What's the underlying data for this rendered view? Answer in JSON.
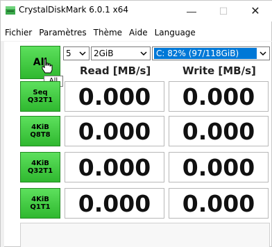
{
  "window": {
    "title": "CrystalDiskMark 6.0.1 x64",
    "minimize": "—",
    "maximize": "☐",
    "close": "✕"
  },
  "menu": [
    "Fichier",
    "Paramètres",
    "Thème",
    "Aide",
    "Language"
  ],
  "controls": {
    "all_label": "All",
    "tooltip": "All",
    "count_value": "5",
    "size_value": "2GiB",
    "drive_value": "C: 82% (97/118GiB)"
  },
  "headers": {
    "read": "Read [MB/s]",
    "write": "Write [MB/s]"
  },
  "tests": [
    {
      "line1": "Seq",
      "line2": "Q32T1",
      "read": "0.000",
      "write": "0.000"
    },
    {
      "line1": "4KiB",
      "line2": "Q8T8",
      "read": "0.000",
      "write": "0.000"
    },
    {
      "line1": "4KiB",
      "line2": "Q32T1",
      "read": "0.000",
      "write": "0.000"
    },
    {
      "line1": "4KiB",
      "line2": "Q1T1",
      "read": "0.000",
      "write": "0.000"
    }
  ],
  "colors": {
    "button_green": "#3cc83c",
    "selection_blue": "#0078d7"
  },
  "icons": {
    "app": "crystaldiskmark-app-icon",
    "cursor": "hand-pointer-icon"
  }
}
